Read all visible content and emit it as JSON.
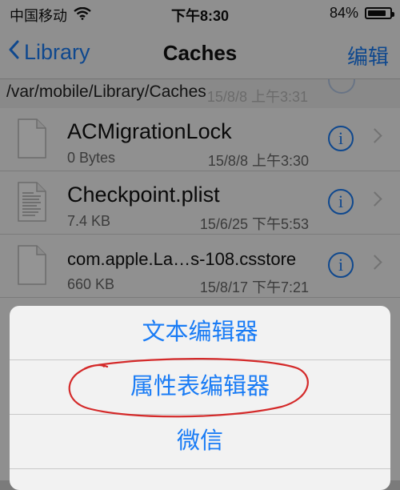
{
  "status_bar": {
    "carrier": "中国移动",
    "time": "下午8:30",
    "battery": "84%",
    "battery_level": 0.84
  },
  "nav": {
    "back_label": "Library",
    "title": "Caches",
    "edit_label": "编辑"
  },
  "path": {
    "text": "/var/mobile/Library/Caches",
    "hidden_date": "15/8/8 上午3:31"
  },
  "files": [
    {
      "name": "ACMigrationLock",
      "size": "0 Bytes",
      "date": "15/8/8 上午3:30",
      "icon": "document-icon"
    },
    {
      "name": "Checkpoint.plist",
      "size": "7.4 KB",
      "date": "15/6/25 下午5:53",
      "icon": "text-document-icon"
    },
    {
      "name": "com.apple.La…s-108.csstore",
      "size": "660 KB",
      "date": "15/8/17 下午7:21",
      "icon": "document-icon"
    }
  ],
  "action_sheet": {
    "options": [
      {
        "label": "文本编辑器"
      },
      {
        "label": "属性表编辑器"
      },
      {
        "label": "微信"
      }
    ]
  },
  "colors": {
    "accent": "#1a7cf5",
    "annotation": "#d42a2a"
  }
}
